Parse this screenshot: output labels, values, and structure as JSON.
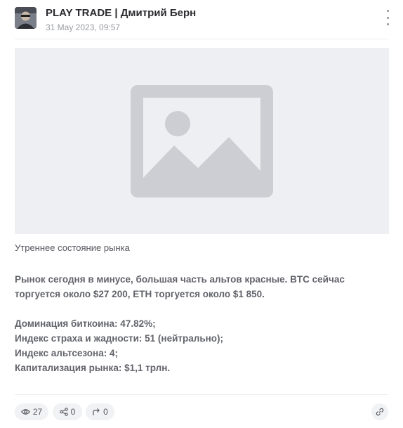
{
  "post": {
    "channel_name": "PLAY TRADE | Дмитрий Берн",
    "date": "31 May 2023, 09:57",
    "avatar_icon": "user-avatar",
    "image": {
      "icon": "image-placeholder-icon",
      "background": "#eeeff2",
      "icon_color": "#cdced4"
    },
    "caption": "Утреннее состояние рынка",
    "paragraph_1": {
      "line_1": "Рынок сегодня в минусе, большая часть альтов красные. BTC сейчас",
      "line_2": "торгуется около $27 200, ETH торгуется около $1 850."
    },
    "stats": {
      "line_1": "Доминация биткоина: 47.82%;",
      "line_2": "Индекс страха и жадности: 51 (нейтрально);",
      "line_3": "Индекс альтсезона: 4;",
      "line_4": "Капитализация рынка: $1,1 трлн."
    }
  },
  "footer": {
    "views": {
      "icon": "eye-icon",
      "count": "27"
    },
    "reactions": {
      "icon": "share-nodes-icon",
      "count": "0"
    },
    "shares": {
      "icon": "forward-arrow-icon",
      "count": "0"
    },
    "link": {
      "icon": "link-icon"
    }
  }
}
